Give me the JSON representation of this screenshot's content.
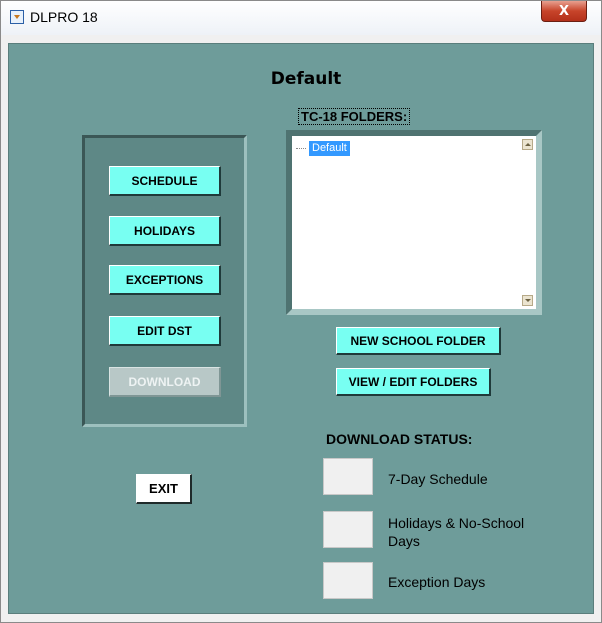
{
  "window": {
    "title": "DLPRO 18",
    "close_label": "X"
  },
  "main": {
    "folder_title": "Default",
    "folders_label": "TC-18 FOLDERS:",
    "tree_items": [
      "Default"
    ]
  },
  "left_panel": {
    "schedule_label": "SCHEDULE",
    "holidays_label": "HOLIDAYS",
    "exceptions_label": "EXCEPTIONS",
    "edit_dst_label": "EDIT DST",
    "download_label": "DOWNLOAD",
    "download_enabled": false
  },
  "folder_buttons": {
    "new_folder_label": "NEW SCHOOL FOLDER",
    "view_edit_label": "VIEW / EDIT FOLDERS"
  },
  "exit_label": "EXIT",
  "download_status": {
    "label": "DOWNLOAD STATUS:",
    "items": [
      {
        "label": "7-Day Schedule"
      },
      {
        "label": "Holidays & No-School Days"
      },
      {
        "label": "Exception Days"
      }
    ]
  },
  "colors": {
    "background": "#6e9c9a",
    "button_accent": "#78fff2",
    "selection": "#3399ff"
  }
}
